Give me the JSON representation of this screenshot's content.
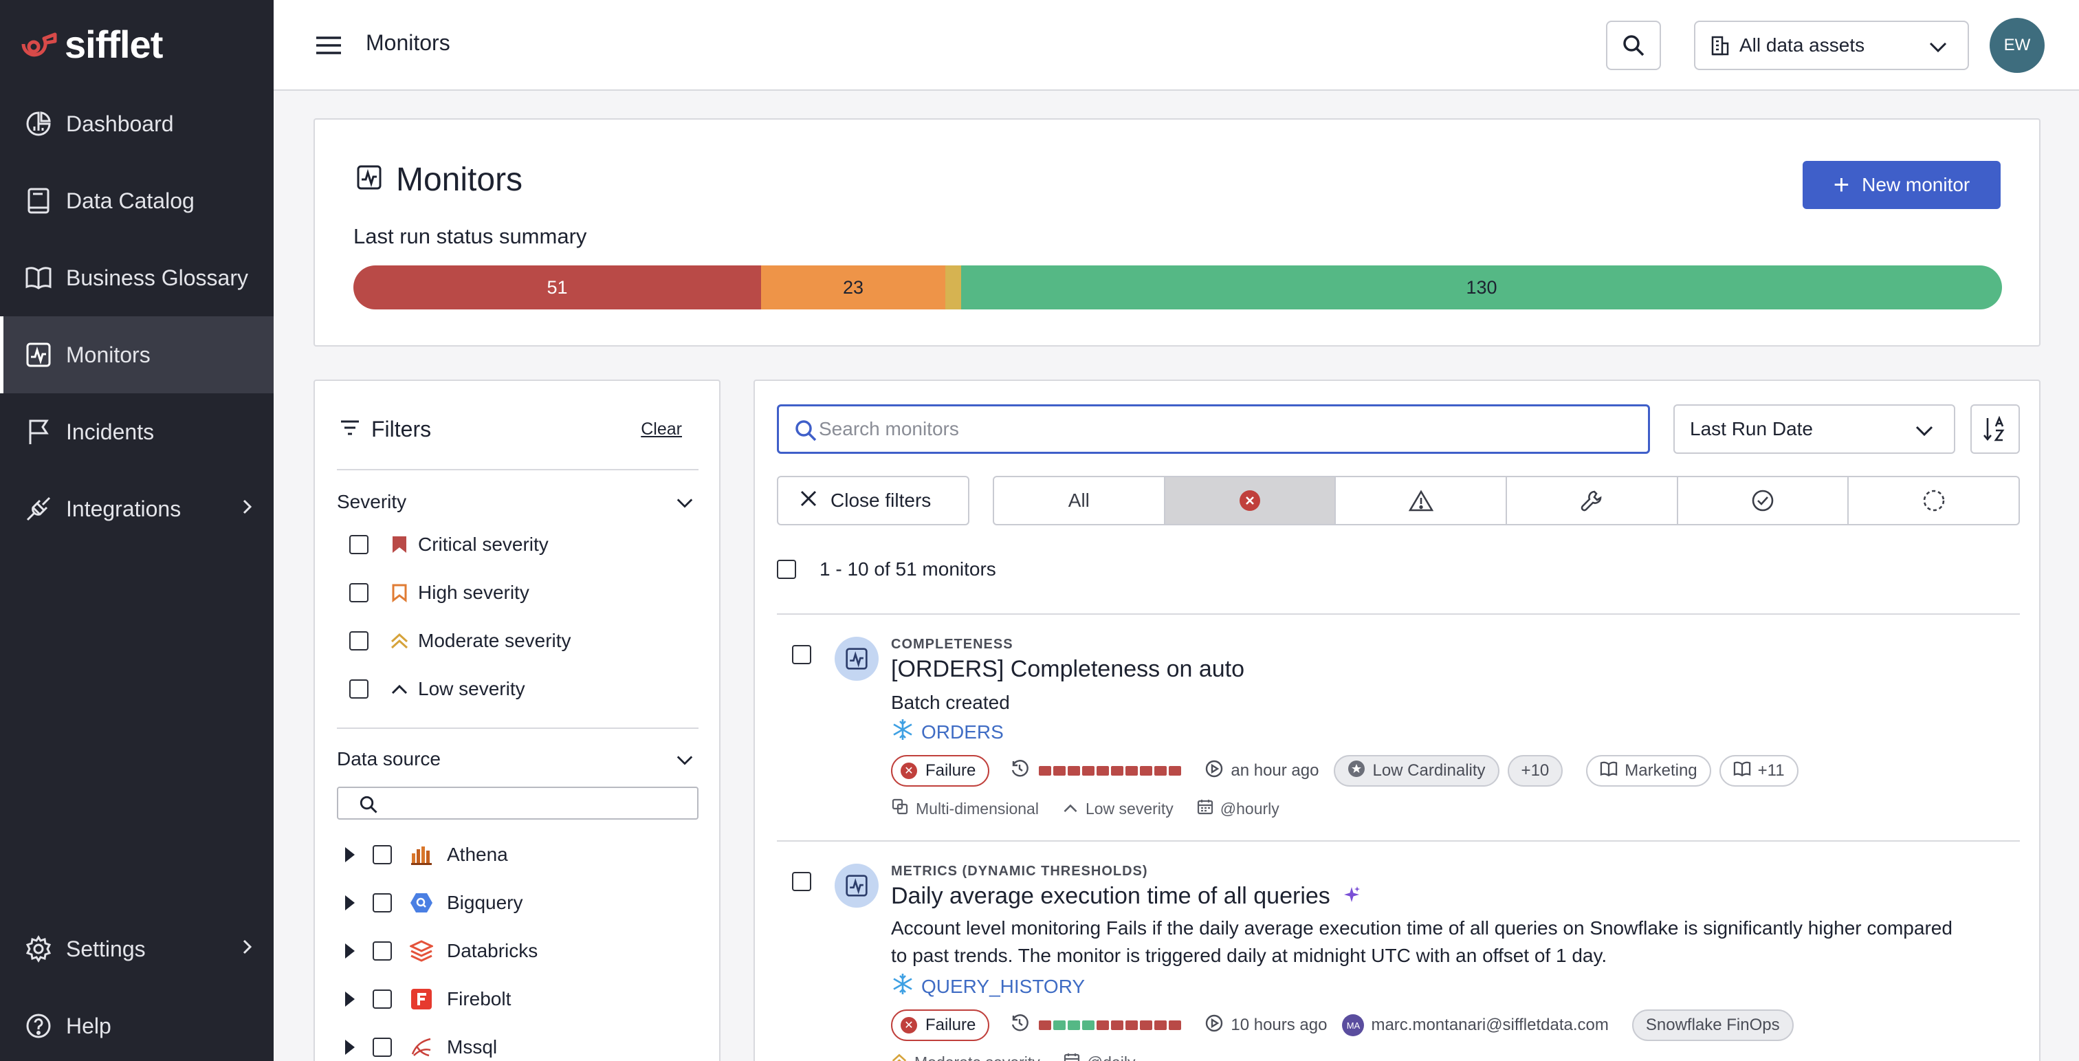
{
  "app": {
    "brand": "sifflet",
    "user_initials": "EW"
  },
  "colors": {
    "sidebar_bg": "#23252e",
    "accent": "#3f5fc9",
    "failure": "#b94a47",
    "warning": "#ee9448",
    "moderate": "#d6b351",
    "success": "#55b885"
  },
  "sidebar": {
    "items": [
      {
        "label": "Dashboard",
        "icon": "dashboard-icon"
      },
      {
        "label": "Data Catalog",
        "icon": "book-icon"
      },
      {
        "label": "Business Glossary",
        "icon": "open-book-icon"
      },
      {
        "label": "Monitors",
        "icon": "monitor-pulse-icon",
        "active": true
      },
      {
        "label": "Incidents",
        "icon": "flag-icon"
      },
      {
        "label": "Integrations",
        "icon": "plug-icon",
        "has_submenu": true
      }
    ],
    "bottom": [
      {
        "label": "Settings",
        "icon": "gear-icon",
        "has_submenu": true
      },
      {
        "label": "Help",
        "icon": "help-icon"
      }
    ]
  },
  "topbar": {
    "title": "Monitors",
    "assets_select": "All data assets"
  },
  "header": {
    "title": "Monitors",
    "new_button": "New monitor",
    "summary_label": "Last run status summary",
    "status_summary": {
      "failure": 51,
      "warning": 23,
      "moderate_fraction": 0.009,
      "success": 130
    }
  },
  "filters": {
    "title": "Filters",
    "clear": "Clear",
    "severity": {
      "title": "Severity",
      "options": [
        "Critical severity",
        "High severity",
        "Moderate severity",
        "Low severity"
      ]
    },
    "data_source": {
      "title": "Data source",
      "search_placeholder": "",
      "options": [
        "Athena",
        "Bigquery",
        "Databricks",
        "Firebolt",
        "Mssql"
      ]
    }
  },
  "list": {
    "search_placeholder": "Search monitors",
    "sort_by": "Last Run Date",
    "close_filters": "Close filters",
    "tabs": [
      "All",
      "failure-icon",
      "warning-icon",
      "wrench-icon",
      "check-circle-icon",
      "pending-icon"
    ],
    "count": "1 - 10 of 51 monitors",
    "monitors": [
      {
        "type": "COMPLETENESS",
        "title": "[ORDERS] Completeness on auto",
        "description": "Batch created",
        "asset": "ORDERS",
        "status": "Failure",
        "runs": [
          "f",
          "f",
          "f",
          "f",
          "f",
          "f",
          "f",
          "f",
          "f",
          "f"
        ],
        "last_run": "an hour ago",
        "tag1": "Low Cardinality",
        "tag1_more": "+10",
        "domain": "Marketing",
        "domain_more": "+11",
        "kind": "Multi-dimensional",
        "severity": "Low severity",
        "schedule": "@hourly"
      },
      {
        "type": "METRICS (DYNAMIC THRESHOLDS)",
        "title": "Daily average execution time of all queries",
        "description": "Account level monitoring Fails if the daily average execution time of all queries on Snowflake is significantly higher compared to past trends. The monitor is triggered daily at midnight UTC with an offset of 1 day.",
        "asset": "QUERY_HISTORY",
        "status": "Failure",
        "runs": [
          "f",
          "s",
          "s",
          "s",
          "f",
          "f",
          "f",
          "f",
          "f",
          "f"
        ],
        "last_run": "10 hours ago",
        "owner_initials": "MA",
        "owner": "marc.montanari@siffletdata.com",
        "tag1": "Snowflake FinOps",
        "severity": "Moderate severity",
        "schedule": "@daily"
      }
    ]
  }
}
